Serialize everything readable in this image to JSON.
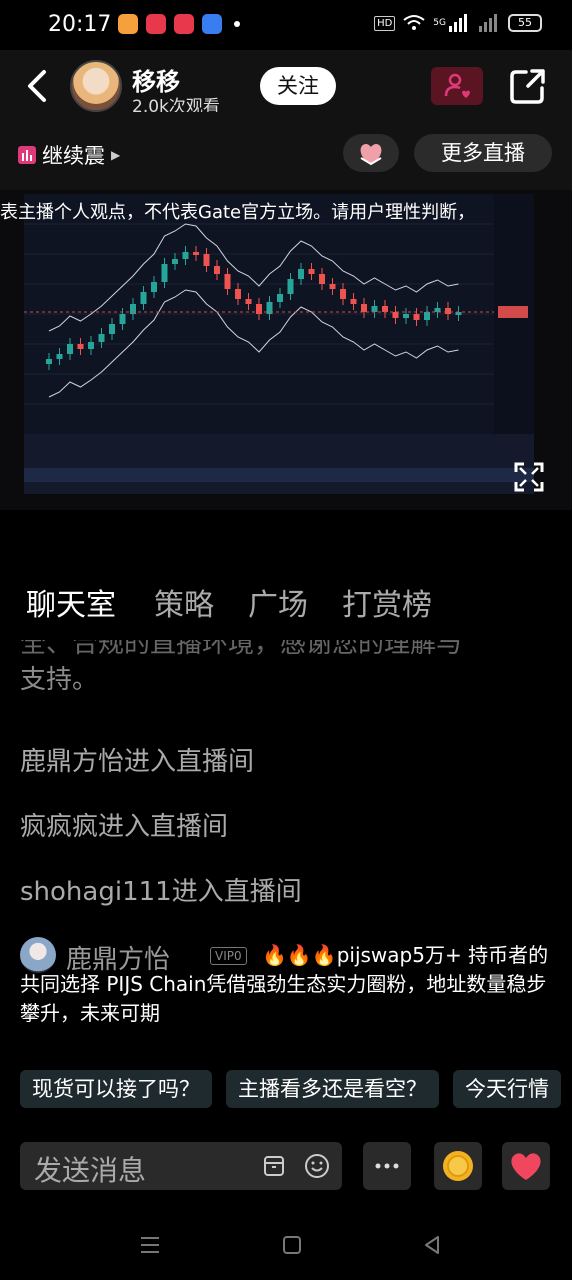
{
  "status_bar": {
    "time": "20:17",
    "hd": "HD",
    "network": "5G",
    "battery": "55",
    "app_icons": [
      {
        "icon": "taobao-app-icon",
        "color": "#f5a03c"
      },
      {
        "icon": "music-app-icon",
        "color": "#e8384b"
      },
      {
        "icon": "news-app-icon",
        "color": "#e8384b"
      },
      {
        "icon": "blue-app-icon",
        "color": "#3a7df0"
      }
    ]
  },
  "header": {
    "streamer_name": "移移",
    "viewers": "2.0k次观看",
    "follow_label": "关注",
    "live_title": "继续震",
    "more_live_label": "更多直播"
  },
  "video": {
    "disclaimer": "表主播个人观点，不代表Gate官方立场。请用户理性判断，"
  },
  "tabs": [
    {
      "label": "聊天室",
      "active": true
    },
    {
      "label": "策略",
      "active": false
    },
    {
      "label": "广场",
      "active": false
    },
    {
      "label": "打赏榜",
      "active": false
    }
  ],
  "chat": {
    "partial_top": "全、合规的直播环境，感谢您的理解与",
    "partial_end": "支持。",
    "system_messages": [
      "鹿鼎方怡进入直播间",
      "疯疯疯进入直播间",
      "shohagi111进入直播间"
    ],
    "user_message": {
      "name": "鹿鼎方怡",
      "badge": "VIP0",
      "text": "🔥🔥🔥pijswap5万+ 持币者的共同选择 PIJS Chain凭借强劲生态实力圈粉，地址数量稳步攀升，未来可期"
    }
  },
  "quick_replies": [
    "现货可以接了吗？",
    "主播看多还是看空？",
    "今天行情"
  ],
  "input": {
    "placeholder": "发送消息"
  },
  "colors": {
    "accent_pink": "#e0397a",
    "follow_bg": "#ffffff",
    "chip_bg": "#1f2a2e",
    "candle_up": "#26a69a",
    "candle_down": "#ef5350"
  }
}
